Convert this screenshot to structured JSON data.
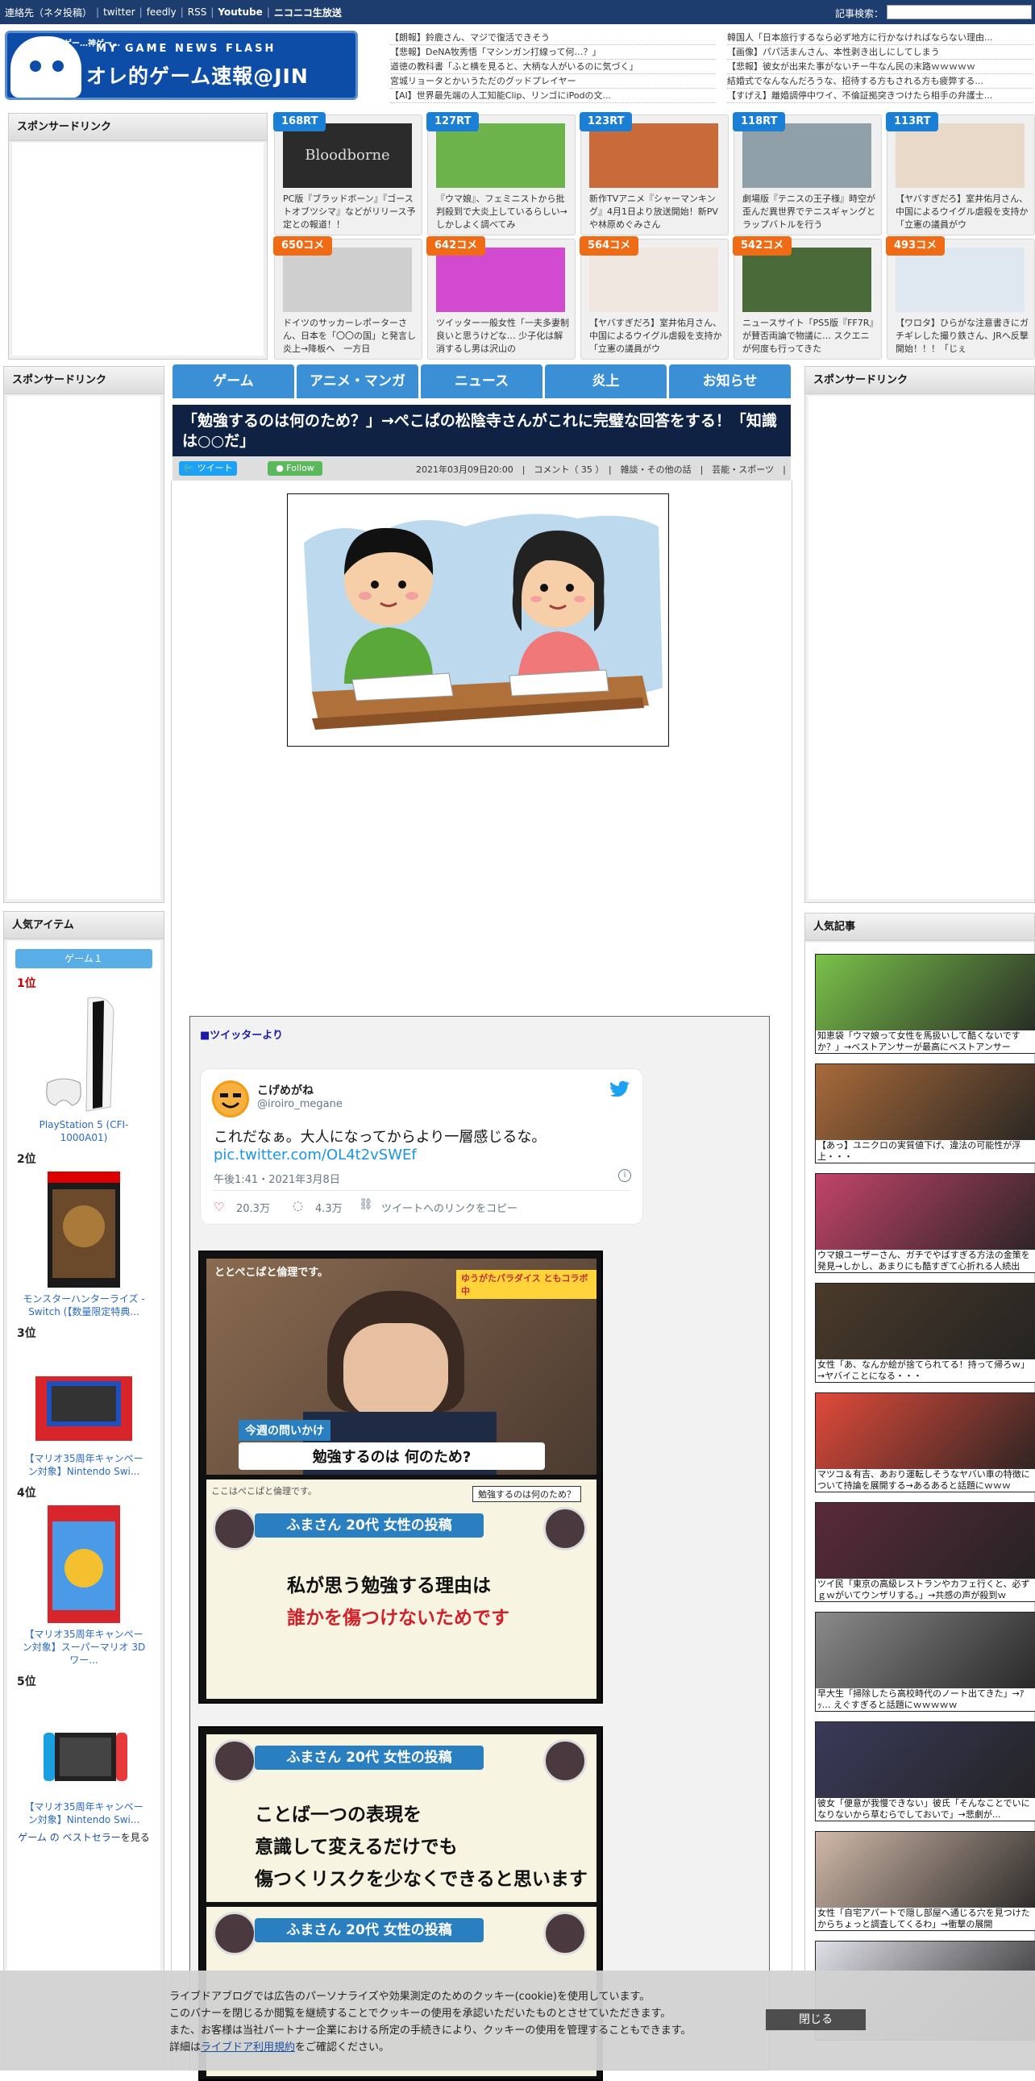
{
  "topbar": {
    "contact": "連絡先（ネタ投稿）",
    "links": [
      "twitter",
      "feedly",
      "RSS"
    ],
    "youtube": "Youtube",
    "nico": "ニコニコ生放送",
    "search_label": "記事検索："
  },
  "logo": {
    "sub": "MY GAME NEWS FLASH",
    "main": "オレ的ゲーム速報@JIN",
    "cry": "神ゲー…神ゲー…"
  },
  "headlines_left": [
    "【朗報】鈴鹿さん、マジで復活できそう",
    "【悲報】DeNA牧秀悟「マシンガン打線って何…？」",
    "道徳の教科書「ふと横を見ると、大柄な人がいるのに気づく」",
    "宮城リョータとかいうただのグッドプレイヤー",
    "【AI】世界最先端の人工知能Clip、リンゴにiPodの文..."
  ],
  "headlines_right": [
    "韓国人「日本旅行するなら必ず地方に行かなければならない理由...",
    "【画像】パパ活まんさん、本性剥き出しにしてしまう",
    "【悲報】彼女が出来た事がないチー牛なん民の末路ｗｗｗｗｗ",
    "結婚式でなんなんだろうな、招待する方もされる方も疲弊する...",
    "【すげえ】離婚調停中ワイ、不倫証拠突きつけたら相手の弁護士..."
  ],
  "sponsor_label": "スポンサードリンク",
  "cards": [
    {
      "tag": "168RT",
      "kind": "rt",
      "title": "PC版『ブラッドボーン』『ゴーストオブツシマ』などがリリース予定との報道！！",
      "color": "#2b2b2b",
      "img_text": "Bloodborne"
    },
    {
      "tag": "127RT",
      "kind": "rt",
      "title": "『ウマ娘』、フェミニストから批判殺到で大炎上しているらしい→しかしよく調べてみ",
      "color": "#6bb34a",
      "img_text": ""
    },
    {
      "tag": "123RT",
      "kind": "rt",
      "title": "新作TVアニメ『シャーマンキング』4月1日より放送開始！新PVや林原めぐみさん",
      "color": "#c86a3a",
      "img_text": ""
    },
    {
      "tag": "118RT",
      "kind": "rt",
      "title": "劇場版『テニスの王子様』時空が歪んだ異世界でテニスギャングとラップバトルを行う",
      "color": "#8fa0a8",
      "img_text": ""
    },
    {
      "tag": "113RT",
      "kind": "rt",
      "title": "【ヤバすぎだろ】室井佑月さん、中国によるウイグル虐殺を支持か「立憲の議員がウ",
      "color": "#e8d9c8",
      "img_text": ""
    },
    {
      "tag": "650コメ",
      "kind": "cm",
      "title": "ドイツのサッカーレポーターさん、日本を「〇〇の国」と発言し炎上→降板へ　一方日",
      "color": "#cfcfcf",
      "img_text": ""
    },
    {
      "tag": "642コメ",
      "kind": "cm",
      "title": "ツイッター一般女性「一夫多妻制良いと思うけどな… 少子化は解消するし男は沢山の",
      "color": "#d24ad0",
      "img_text": ""
    },
    {
      "tag": "564コメ",
      "kind": "cm",
      "title": "【ヤバすぎだろ】室井佑月さん、中国によるウイグル虐殺を支持か「立憲の議員がウ",
      "color": "#f0e8e0",
      "img_text": ""
    },
    {
      "tag": "542コメ",
      "kind": "cm",
      "title": "ニュースサイト「PS5版『FF7R』が賛否両論で物議に… スクエニが何度も行ってきた",
      "color": "#4a6a3a",
      "img_text": ""
    },
    {
      "tag": "493コメ",
      "kind": "cm",
      "title": "【ワロタ】ひらがな注意書きにガチギレした撮り鉄さん、JRへ反撃開始！！！「じぇ",
      "color": "#dfe8f0",
      "img_text": ""
    }
  ],
  "nav": [
    "ゲーム",
    "アニメ・マンガ",
    "ニュース",
    "炎上",
    "お知らせ"
  ],
  "article": {
    "title": "「勉強するのは何のため？」→ぺこぱの松陰寺さんがこれに完璧な回答をする！「知識は○○だ」",
    "tweet_btn": "ツイート",
    "follow_btn": "Follow",
    "meta": "2021年03月09日20:00　|　コメント（ 35 ）　|　雑談・その他の話　|　芸能・スポーツ　|"
  },
  "quote": {
    "label": "■ツイッターより",
    "tweet": {
      "name": "こげめがね",
      "handle": "@iroiro_megane",
      "text": "これだなぁ。大人になってからより一層感じるな。",
      "link": "pic.twitter.com/OL4t2vSWEf",
      "time": "午後1:41・2021年3月8日",
      "likes": "20.3万",
      "replies": "4.3万",
      "copy": "ツイートへのリンクをコピー"
    },
    "embed1": {
      "top_tag": "ととぺこぱと倫理です。",
      "collab": "ゆうがたパラダイス ともコラボ中",
      "question_label": "今週の問いかけ",
      "question": "勉強するのは 何のため?",
      "header2": "ふまさん 20代 女性の投稿",
      "corner2": "勉強するのは何のため？",
      "line1": "私が思う勉強する理由は",
      "line2": "誰かを傷つけないためです",
      "small2": "ここはぺこぱと倫理です。"
    },
    "embed2": {
      "header": "ふまさん 20代 女性の投稿",
      "line1": "ことば一つの表現を",
      "line2": "意識して変えるだけでも",
      "line3": "傷つくリスクを少なくできると思います",
      "header_b": "ふまさん 20代 女性の投稿"
    }
  },
  "popular_items": {
    "title": "人気アイテム",
    "tab": "ゲーム１",
    "items": [
      {
        "rank": "1位",
        "name": "PlayStation 5 (CFI-1000A01)"
      },
      {
        "rank": "2位",
        "name": "モンスターハンターライズ -Switch (【数量限定特典..."
      },
      {
        "rank": "3位",
        "name": "【マリオ35周年キャンペーン対象】Nintendo Swi..."
      },
      {
        "rank": "4位",
        "name": "【マリオ35周年キャンペーン対象】スーパーマリオ 3Dワー..."
      },
      {
        "rank": "5位",
        "name": "【マリオ35周年キャンペーン対象】Nintendo Swi..."
      }
    ],
    "bestseller_link": "ゲーム の ベストセラー",
    "bestseller_suffix": "を見る"
  },
  "popular_articles": {
    "title": "人気記事",
    "items": [
      {
        "cap": "知恵袋「ウマ娘って女性を馬扱いして酷くないですか？」→ベストアンサーが最高にベストアンサー",
        "color": "#7ac24a"
      },
      {
        "cap": "【あっ】ユニクロの実質値下げ、違法の可能性が浮上・・・",
        "color": "#a86a3a"
      },
      {
        "cap": "ウマ娘ユーザーさん、ガチでやばすぎる方法の金策を発見→しかし、あまりにも酷すぎて心折れる人続出",
        "color": "#c2446a"
      },
      {
        "cap": "女性「あ、なんか絵が捨てられてる！持って帰ろｗ」→ヤバイことになる・・・",
        "color": "#4a3a2a"
      },
      {
        "cap": "マツコ＆有吉、あおり運転しそうなヤバい車の特徴について持論を展開する→あるあると話題にｗｗｗ",
        "color": "#e04a3a"
      },
      {
        "cap": "ツイ民「東京の高級レストランやカフェ行くと、必ずｇｗがいてウンザリする。」→共感の声が殺到ｗ",
        "color": "#5a2a3a"
      },
      {
        "cap": "早大生「掃除したら高校時代のノート出てきた」→ｱｯ… えぐすぎると話題にｗｗｗｗｗ",
        "color": "#8a8a8a"
      },
      {
        "cap": "彼女「便意が我慢できない」彼氏「そんなことでいになりないから草むらでしておいで」→悲劇が...",
        "color": "#3a3a5a"
      },
      {
        "cap": "女性「自宅アパートで隠し部屋へ通じる穴を見つけたからちょっと調査してくるわ」→衝撃の展開",
        "color": "#d0b8a8"
      },
      {
        "cap": "",
        "color": "#e0e0e8"
      }
    ]
  },
  "cookie": {
    "line1": "ライブドアブログでは広告のパーソナライズや効果測定のためのクッキー(cookie)を使用しています。",
    "line2": "このバナーを閉じるか閲覧を継続することでクッキーの使用を承認いただいたものとさせていただきます。",
    "line3": "また、お客様は当社パートナー企業における所定の手続きにより、クッキーの使用を管理することもできます。",
    "line4_pre": "詳細は",
    "line4_link": "ライブドア利用規約",
    "line4_post": "をご確認ください。",
    "close": "閉じる"
  }
}
